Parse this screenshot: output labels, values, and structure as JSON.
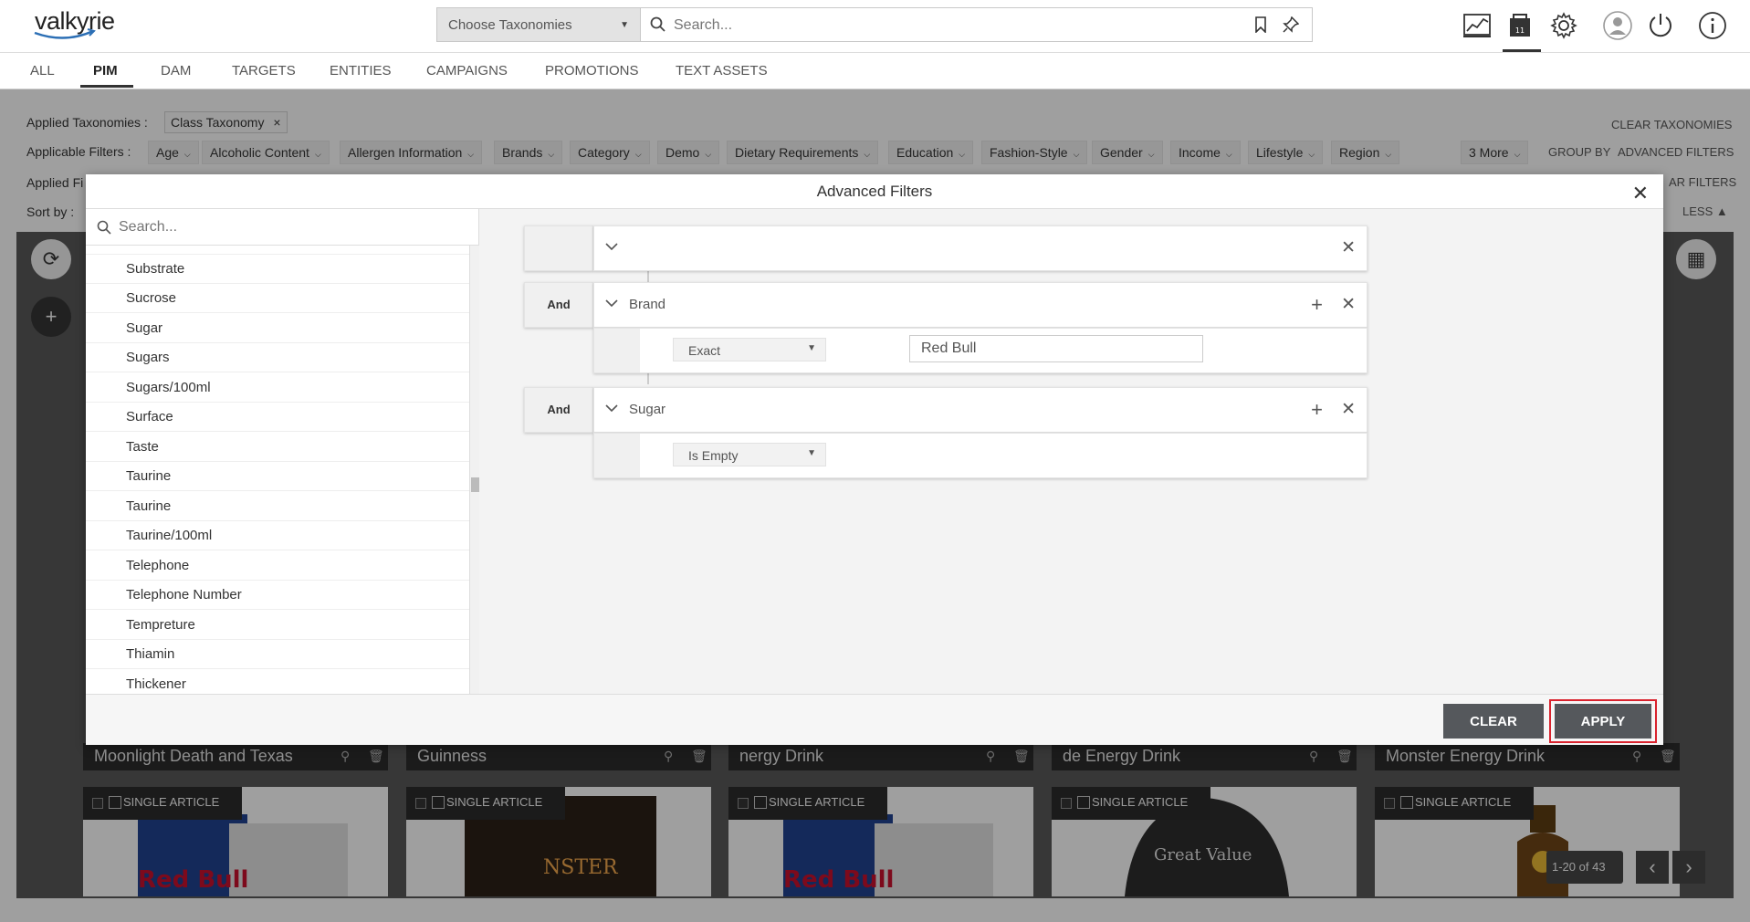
{
  "app": {
    "logo_text": "valkyrie"
  },
  "topbar": {
    "taxonomy_dropdown": "Choose Taxonomies",
    "search_placeholder": "Search..."
  },
  "nav": {
    "tabs": [
      "ALL",
      "PIM",
      "DAM",
      "TARGETS",
      "ENTITIES",
      "CAMPAIGNS",
      "PROMOTIONS",
      "TEXT ASSETS"
    ],
    "active": "PIM"
  },
  "page": {
    "applied_taxonomies_label": "Applied Taxonomies :",
    "taxonomy_chip": "Class Taxonomy",
    "applicable_filters_label": "Applicable Filters :",
    "filters": [
      "Age",
      "Alcoholic Content",
      "Allergen Information",
      "Brands",
      "Category",
      "Demo",
      "Dietary Requirements",
      "Education",
      "Fashion-Style",
      "Gender",
      "Income",
      "Lifestyle",
      "Region"
    ],
    "more_filters": "3 More",
    "clear_taxonomies": "CLEAR TAXONOMIES",
    "group_by": "GROUP BY",
    "advanced_filters": "ADVANCED FILTERS",
    "applied_filters_label": "Applied Fi",
    "clear_filters_partial": "AR FILTERS",
    "sort_by_label": "Sort by :",
    "less_label": "LESS ▲",
    "card_titles": [
      "Moonlight Death and Texas",
      "Guinness",
      "nergy Drink",
      "de Energy Drink",
      "Monster Energy Drink"
    ],
    "card_badge": "SINGLE ARTICLE",
    "pager_text": "1-20 of 43"
  },
  "modal": {
    "title": "Advanced Filters",
    "search_placeholder": "Search...",
    "attributes": [
      "Substrate",
      "Sucrose",
      "Sugar",
      "Sugars",
      "Sugars/100ml",
      "Surface",
      "Taste",
      "Taurine",
      "Taurine",
      "Taurine/100ml",
      "Telephone",
      "Telephone Number",
      "Tempreture",
      "Thiamin",
      "Thickener"
    ],
    "rules": [
      {
        "connector": "",
        "field": "",
        "operator": "",
        "value": ""
      },
      {
        "connector": "And",
        "field": "Brand",
        "operator": "Exact",
        "value": "Red Bull"
      },
      {
        "connector": "And",
        "field": "Sugar",
        "operator": "Is Empty",
        "value": ""
      }
    ],
    "clear_button": "CLEAR",
    "apply_button": "APPLY"
  },
  "colors": {
    "accent_highlight": "#d9232e",
    "button_dark": "#55585c"
  },
  "icons": [
    "search-icon",
    "bookmark-icon",
    "pin-icon",
    "chart-icon",
    "catalog-icon",
    "gear-icon",
    "user-icon",
    "power-icon",
    "info-icon",
    "close-icon",
    "chevron-down-icon",
    "plus-icon"
  ]
}
